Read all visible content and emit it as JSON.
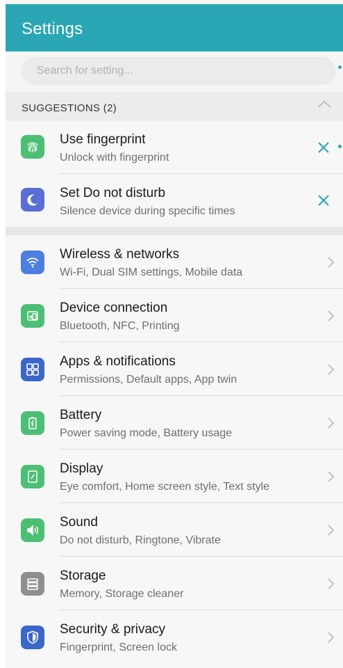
{
  "header": {
    "title": "Settings"
  },
  "search": {
    "placeholder": "Search for setting..."
  },
  "suggestions": {
    "header": "SUGGESTIONS (2)",
    "items": [
      {
        "title": "Use fingerprint",
        "subtitle": "Unlock with fingerprint",
        "icon": "fingerprint-icon",
        "color": "#4cbf74"
      },
      {
        "title": "Set Do not disturb",
        "subtitle": "Silence device during specific times",
        "icon": "moon-icon",
        "color": "#5a6ed6"
      }
    ]
  },
  "settings": {
    "items": [
      {
        "title": "Wireless & networks",
        "subtitle": "Wi-Fi, Dual SIM settings, Mobile data",
        "icon": "wifi-icon",
        "color": "#4c7fe0"
      },
      {
        "title": "Device connection",
        "subtitle": "Bluetooth, NFC, Printing",
        "icon": "device-connection-icon",
        "color": "#4cbf74"
      },
      {
        "title": "Apps & notifications",
        "subtitle": "Permissions, Default apps, App twin",
        "icon": "apps-grid-icon",
        "color": "#3a67c8"
      },
      {
        "title": "Battery",
        "subtitle": "Power saving mode, Battery usage",
        "icon": "battery-icon",
        "color": "#4cbf74"
      },
      {
        "title": "Display",
        "subtitle": "Eye comfort, Home screen style, Text style",
        "icon": "display-icon",
        "color": "#4cbf74"
      },
      {
        "title": "Sound",
        "subtitle": "Do not disturb, Ringtone, Vibrate",
        "icon": "speaker-icon",
        "color": "#4cbf74"
      },
      {
        "title": "Storage",
        "subtitle": "Memory, Storage cleaner",
        "icon": "storage-icon",
        "color": "#8f8f8f"
      },
      {
        "title": "Security & privacy",
        "subtitle": "Fingerprint, Screen lock",
        "icon": "shield-icon",
        "color": "#3a67c8"
      }
    ]
  },
  "colors": {
    "accent": "#2aa6b4",
    "dismiss": "#2aa6b4"
  }
}
